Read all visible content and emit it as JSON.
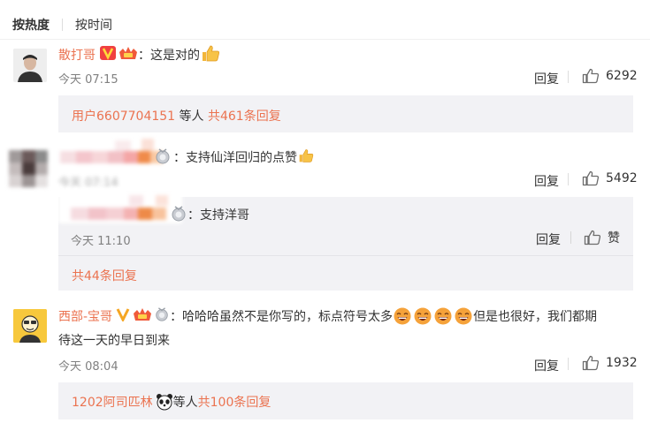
{
  "sort": {
    "hot": "按热度",
    "time": "按时间"
  },
  "c1": {
    "user": "散打哥",
    "text": "：这是对的",
    "time": "今天 07:15",
    "reply_label": "回复",
    "likes": "6292",
    "replies": {
      "user": "用户6607704151",
      "mid": " 等人 ",
      "count": "共461条回复"
    }
  },
  "c2": {
    "text": "：支持仙洋回归的点赞",
    "time": "今天 07:14",
    "reply_label": "回复",
    "likes": "5492",
    "sub": {
      "text": "：支持洋哥",
      "time": "今天 11:10",
      "reply_label": "回复",
      "like_label": "赞"
    },
    "more": "共44条回复"
  },
  "c3": {
    "user": "西部-宝哥",
    "text_line1": "：哈哈哈虽然不是你写的，标点符号太多",
    "text_line1b": "但是也很好，我们都期",
    "text_line2": "待这一天的早日到来",
    "time": "今天 08:04",
    "reply_label": "回复",
    "likes": "1932",
    "replies": {
      "user": "1202阿司匹林",
      "mid": " 等人 ",
      "count": "共100条回复"
    }
  }
}
